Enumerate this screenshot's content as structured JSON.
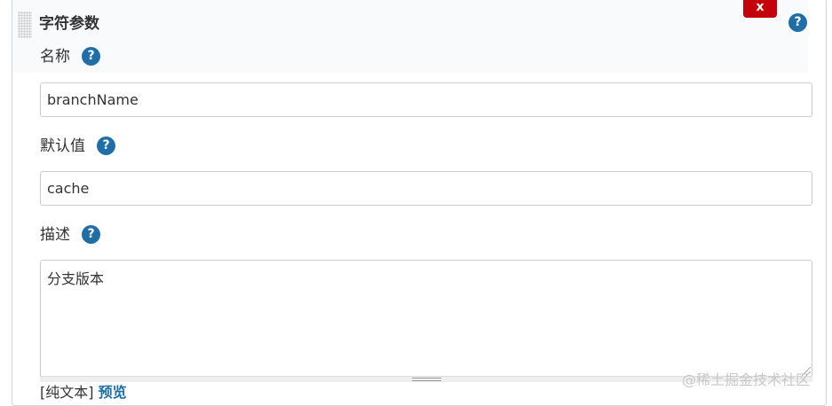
{
  "section": {
    "title": "字符参数",
    "delete_label": "x",
    "help_glyph": "?"
  },
  "fields": {
    "name": {
      "label": "名称",
      "value": "branchName"
    },
    "default_value": {
      "label": "默认值",
      "value": "cache"
    },
    "description": {
      "label": "描述",
      "value": "分支版本"
    }
  },
  "format": {
    "plain_text": "[纯文本]",
    "preview": "预览"
  },
  "watermark": "@稀土掘金技术社区",
  "colors": {
    "delete_button": "#c4000a",
    "help_icon": "#1f6ea7",
    "link": "#1f6ea7"
  }
}
